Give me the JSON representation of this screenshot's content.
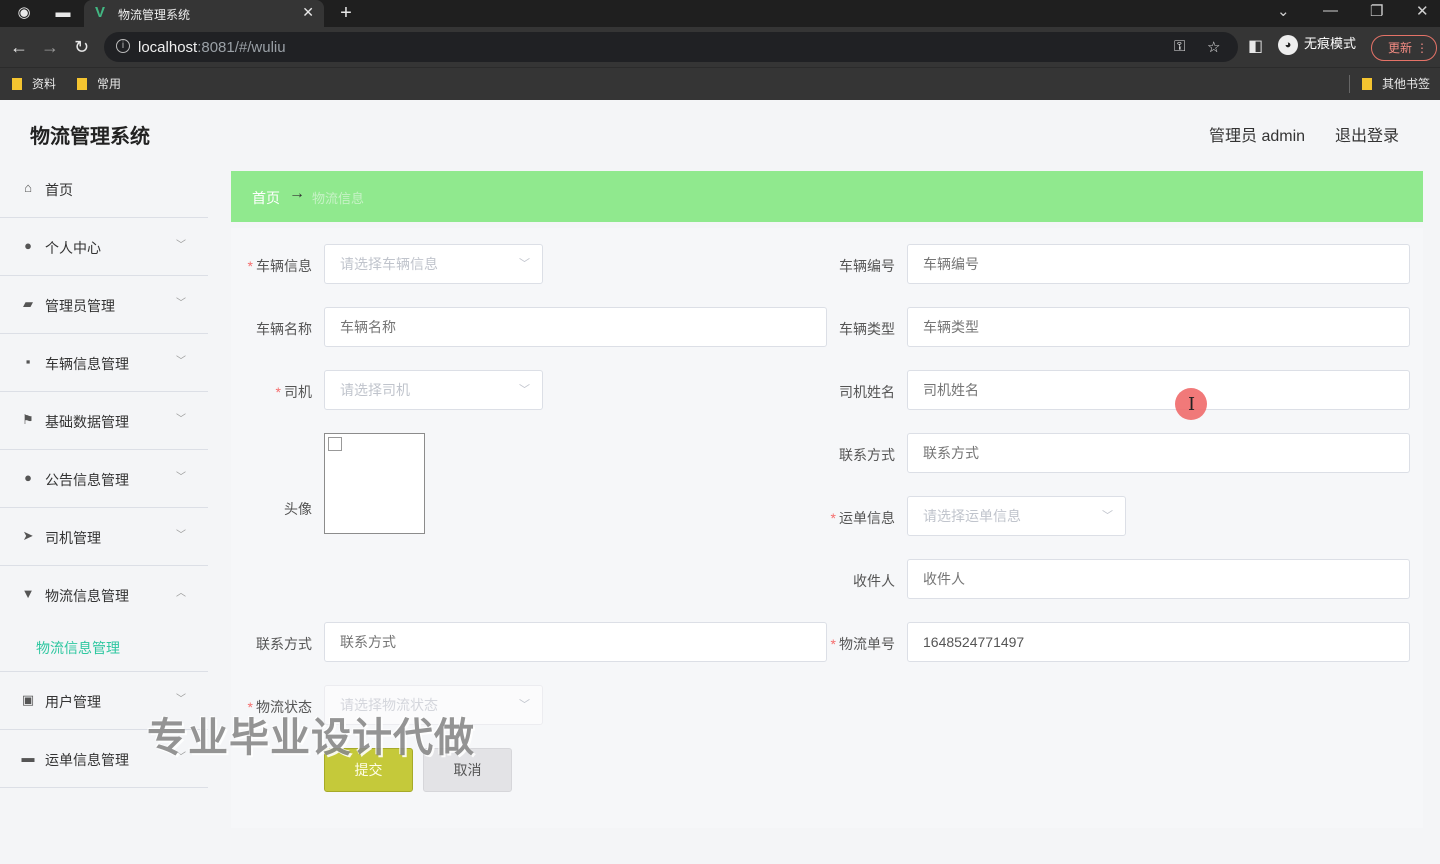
{
  "browser": {
    "tab_title": "物流管理系统",
    "url_host": "localhost",
    "url_rest": ":8081/#/wuliu",
    "incognito_label": "无痕模式",
    "update_label": "更新",
    "bookmarks": [
      "资料",
      "常用"
    ],
    "other_bookmarks": "其他书签"
  },
  "header": {
    "title": "物流管理系统",
    "user": "管理员 admin",
    "logout": "退出登录"
  },
  "sidebar": {
    "items": [
      {
        "label": "首页",
        "icon": "home-icon"
      },
      {
        "label": "个人中心",
        "icon": "user-icon"
      },
      {
        "label": "管理员管理",
        "icon": "briefcase-icon"
      },
      {
        "label": "车辆信息管理",
        "icon": "chat-icon"
      },
      {
        "label": "基础数据管理",
        "icon": "flag-icon"
      },
      {
        "label": "公告信息管理",
        "icon": "bulb-icon"
      },
      {
        "label": "司机管理",
        "icon": "send-icon"
      },
      {
        "label": "物流信息管理",
        "icon": "sign-icon"
      },
      {
        "label": "用户管理",
        "icon": "chart-icon"
      },
      {
        "label": "运单信息管理",
        "icon": "truck-icon"
      }
    ],
    "active_sub": "物流信息管理"
  },
  "breadcrumb": {
    "home": "首页",
    "current": "物流信息"
  },
  "form": {
    "vehicle_info": {
      "label": "车辆信息",
      "placeholder": "请选择车辆信息"
    },
    "vehicle_no": {
      "label": "车辆编号",
      "placeholder": "车辆编号"
    },
    "vehicle_name": {
      "label": "车辆名称",
      "placeholder": "车辆名称"
    },
    "vehicle_type": {
      "label": "车辆类型",
      "placeholder": "车辆类型"
    },
    "driver": {
      "label": "司机",
      "placeholder": "请选择司机"
    },
    "driver_name": {
      "label": "司机姓名",
      "placeholder": "司机姓名"
    },
    "avatar": {
      "label": "头像"
    },
    "driver_phone": {
      "label": "联系方式",
      "placeholder": "联系方式"
    },
    "waybill": {
      "label": "运单信息",
      "placeholder": "请选择运单信息"
    },
    "receiver": {
      "label": "收件人",
      "placeholder": "收件人"
    },
    "contact": {
      "label": "联系方式",
      "placeholder": "联系方式"
    },
    "tracking_no": {
      "label": "物流单号",
      "value": "1648524771497"
    },
    "status": {
      "label": "物流状态",
      "placeholder": "请选择物流状态"
    },
    "submit": "提交",
    "cancel": "取消"
  },
  "watermark": "专业毕业设计代做",
  "colors": {
    "breadcrumb_bg": "#90e98e",
    "submit_bg": "#c5c93a",
    "active_menu": "#2ec7a0",
    "required": "#f56c6c"
  }
}
